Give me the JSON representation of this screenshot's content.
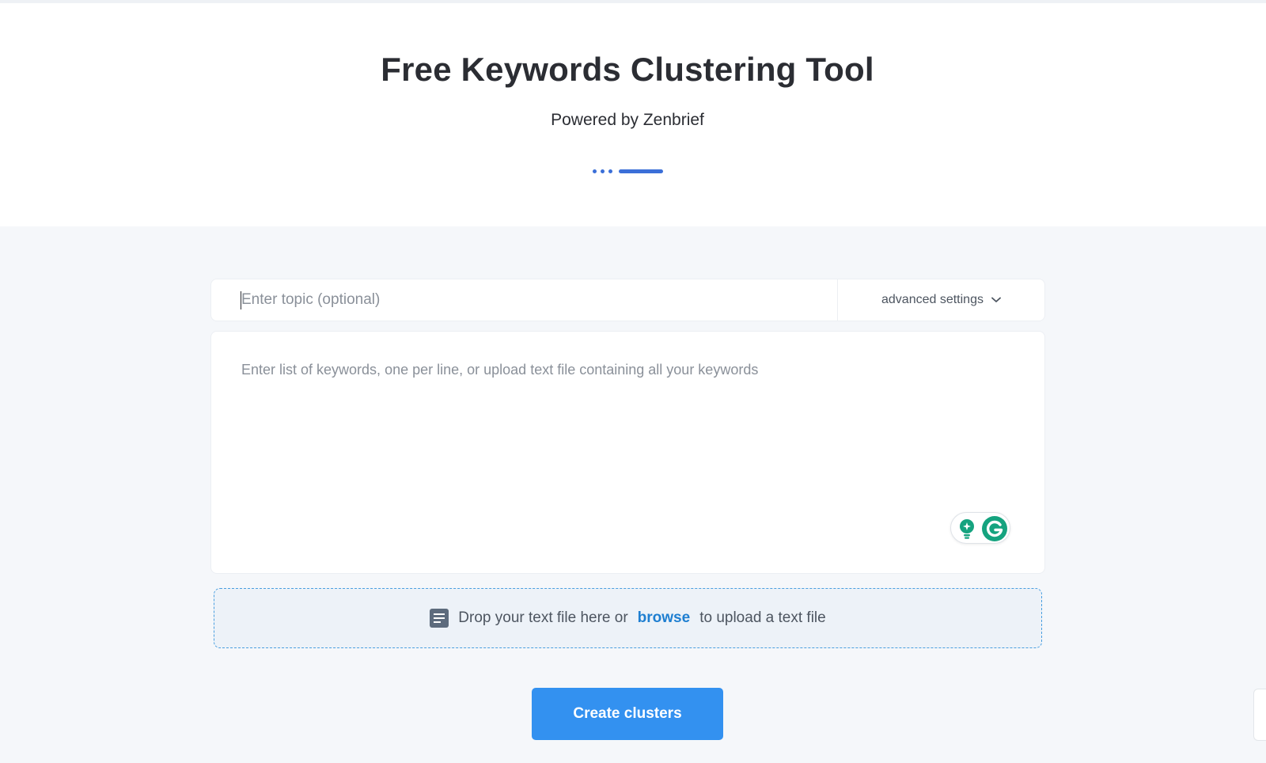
{
  "hero": {
    "title": "Free Keywords Clustering Tool",
    "subtitle": "Powered by Zenbrief"
  },
  "form": {
    "topic_placeholder": "Enter topic (optional)",
    "advanced_settings_label": "advanced settings",
    "keywords_placeholder": "Enter list of keywords, one per line, or upload text file containing all your keywords"
  },
  "dropzone": {
    "text_before": "Drop your text file here or",
    "link_label": "browse",
    "text_after": "to upload a text file"
  },
  "actions": {
    "create_label": "Create clusters"
  },
  "colors": {
    "accent": "#3391f0",
    "link": "#1f7fd1",
    "divider": "#3b6fd8",
    "grammarly": "#15a37f"
  },
  "icons": {
    "advanced": "chevron-down-icon",
    "file": "document-icon",
    "grammarly": "grammarly-icon",
    "assistant": "lightbulb-icon"
  }
}
